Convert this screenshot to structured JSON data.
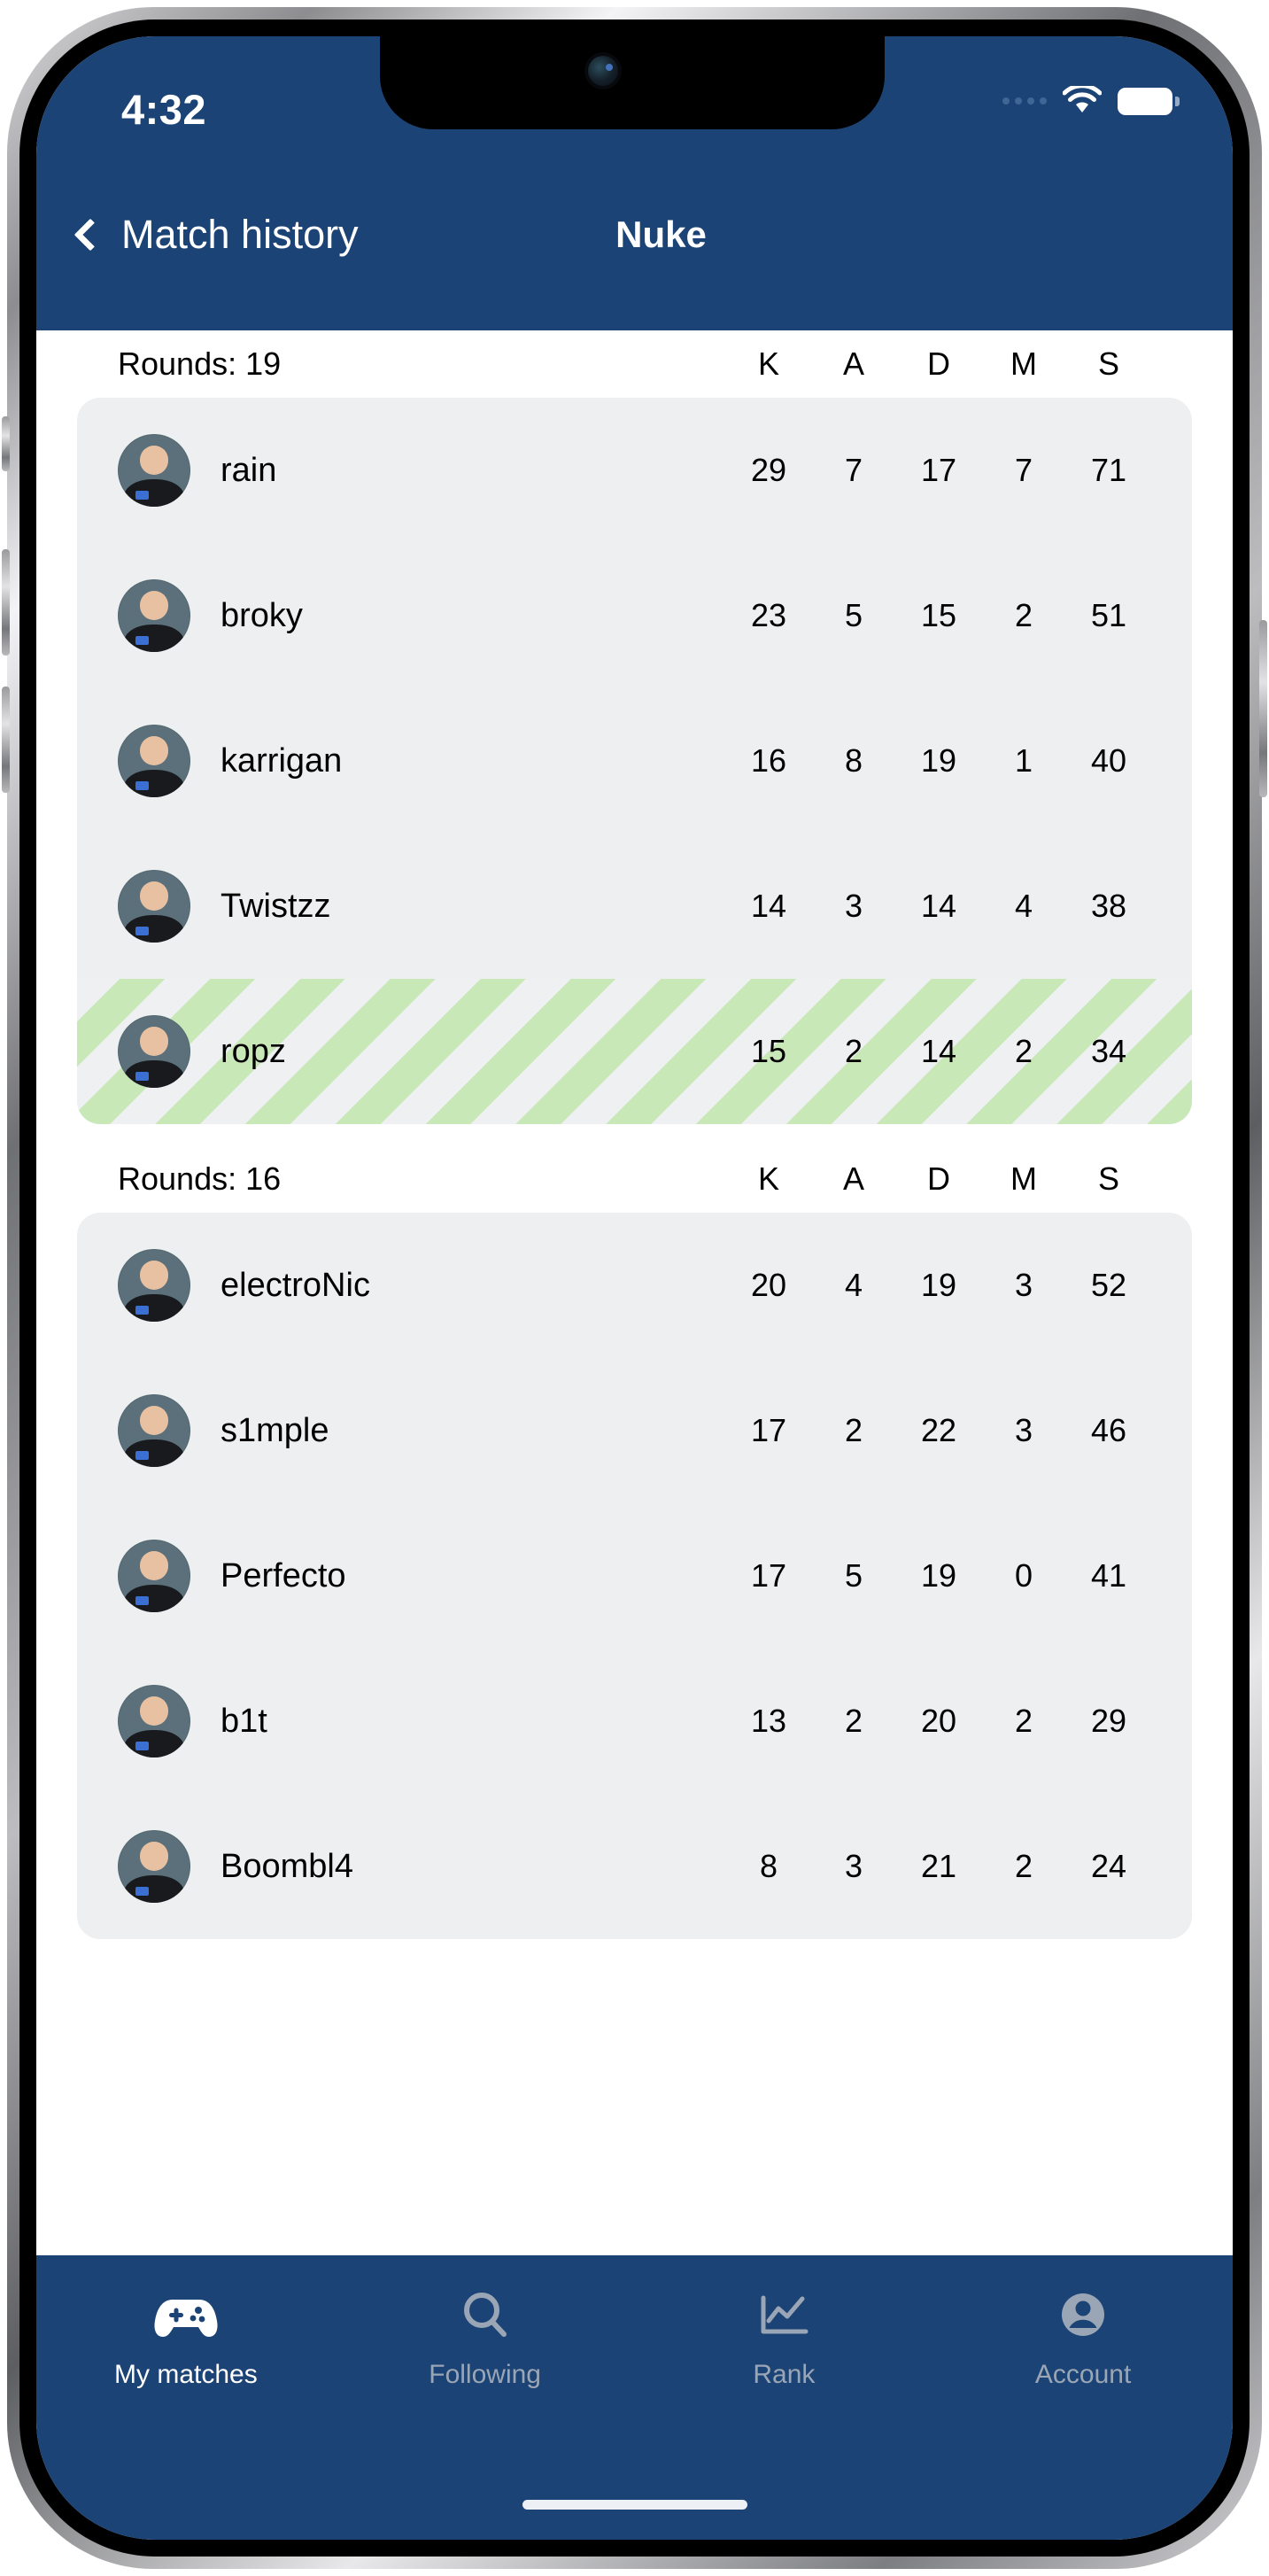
{
  "status": {
    "time": "4:32",
    "icons": [
      "signal-dots-icon",
      "wifi-icon",
      "battery-icon"
    ]
  },
  "nav": {
    "back_label": "Match history",
    "back_icon": "chevron-left-icon",
    "title": "Nuke"
  },
  "theme": {
    "header_blue": "#1b4375",
    "card_gray": "#eeeff1",
    "highlight_green": "#c9e8b8",
    "inactive_tab": "#9aa6b5"
  },
  "columns": [
    "K",
    "A",
    "D",
    "M",
    "S"
  ],
  "sections": [
    {
      "rounds_label": "Rounds: 19",
      "players": [
        {
          "name": "rain",
          "k": "29",
          "a": "7",
          "d": "17",
          "m": "7",
          "s": "71",
          "highlighted": false
        },
        {
          "name": "broky",
          "k": "23",
          "a": "5",
          "d": "15",
          "m": "2",
          "s": "51",
          "highlighted": false
        },
        {
          "name": "karrigan",
          "k": "16",
          "a": "8",
          "d": "19",
          "m": "1",
          "s": "40",
          "highlighted": false
        },
        {
          "name": "Twistzz",
          "k": "14",
          "a": "3",
          "d": "14",
          "m": "4",
          "s": "38",
          "highlighted": false
        },
        {
          "name": "ropz",
          "k": "15",
          "a": "2",
          "d": "14",
          "m": "2",
          "s": "34",
          "highlighted": true
        }
      ]
    },
    {
      "rounds_label": "Rounds: 16",
      "players": [
        {
          "name": "electroNic",
          "k": "20",
          "a": "4",
          "d": "19",
          "m": "3",
          "s": "52",
          "highlighted": false
        },
        {
          "name": "s1mple",
          "k": "17",
          "a": "2",
          "d": "22",
          "m": "3",
          "s": "46",
          "highlighted": false
        },
        {
          "name": "Perfecto",
          "k": "17",
          "a": "5",
          "d": "19",
          "m": "0",
          "s": "41",
          "highlighted": false
        },
        {
          "name": "b1t",
          "k": "13",
          "a": "2",
          "d": "20",
          "m": "2",
          "s": "29",
          "highlighted": false
        },
        {
          "name": "Boombl4",
          "k": "8",
          "a": "3",
          "d": "21",
          "m": "2",
          "s": "24",
          "highlighted": false
        }
      ]
    }
  ],
  "tabs": [
    {
      "label": "My matches",
      "icon": "gamepad-icon",
      "active": true
    },
    {
      "label": "Following",
      "icon": "search-icon",
      "active": false
    },
    {
      "label": "Rank",
      "icon": "chart-line-icon",
      "active": false
    },
    {
      "label": "Account",
      "icon": "person-circle-icon",
      "active": false
    }
  ]
}
